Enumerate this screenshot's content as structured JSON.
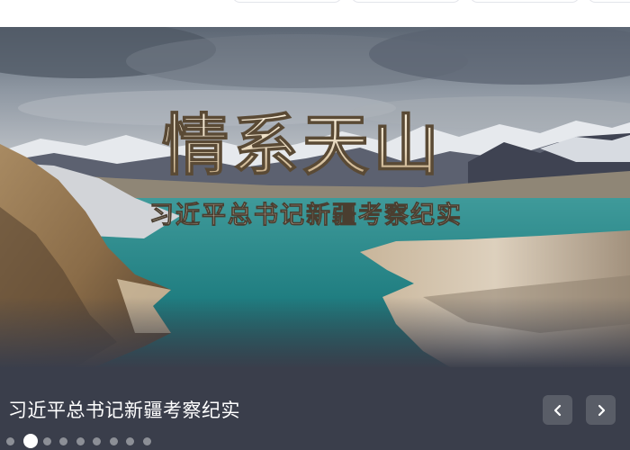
{
  "tabs": [
    {
      "label": ""
    },
    {
      "label": ""
    },
    {
      "label": ""
    },
    {
      "label": ""
    }
  ],
  "slide": {
    "banner_title": "情系天山",
    "banner_subtitle": "习近平总书记新疆考察纪实",
    "caption": "习近平总书记新疆考察纪实"
  },
  "controls": {
    "prev_icon": "chevron-left-icon",
    "next_icon": "chevron-right-icon"
  },
  "pagination": {
    "count": 9,
    "active_index": 1
  },
  "colors": {
    "caption_bar": "#3a3e4b",
    "lake": "#1f7d80",
    "banner_text": "#e8d8bc"
  }
}
